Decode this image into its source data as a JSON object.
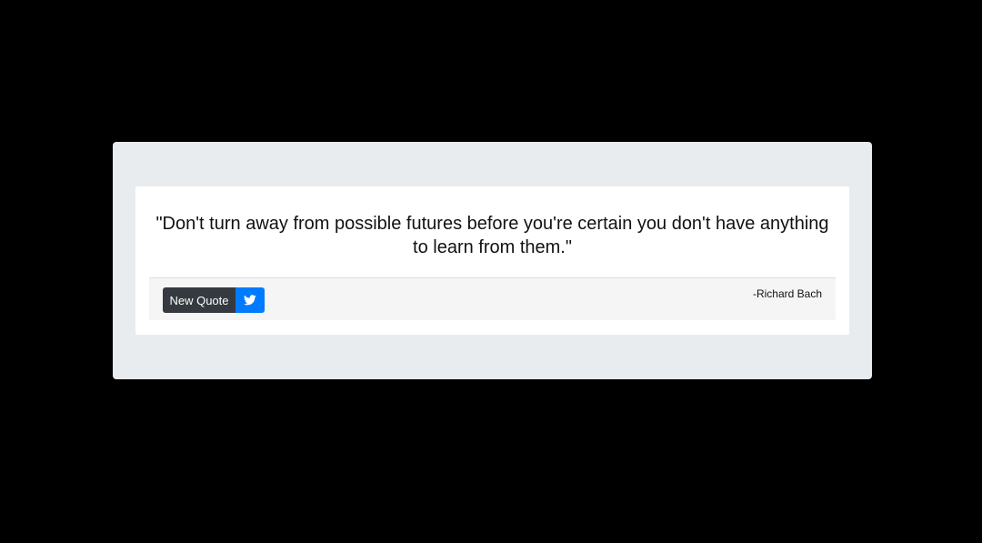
{
  "quote": {
    "text": "\"Don't turn away from possible futures before you're certain you don't have anything to learn from them.\"",
    "author": "-Richard Bach"
  },
  "actions": {
    "new_quote_label": "New Quote",
    "tweet_icon": "twitter-icon"
  },
  "colors": {
    "page_background": "#000000",
    "jumbotron_background": "#e9ecef",
    "card_background": "#ffffff",
    "footer_background": "#f5f5f5",
    "new_quote_button": "#343a40",
    "tweet_button": "#007bff"
  }
}
